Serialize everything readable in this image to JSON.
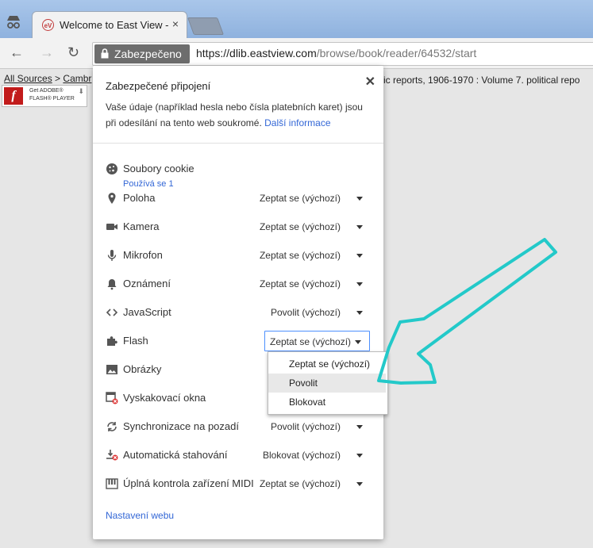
{
  "browser": {
    "tab_title": "Welcome to East View -",
    "tab_close": "×",
    "secure_label": "Zabezpečeno",
    "url_scheme": "https://",
    "url_host": "dlib.eastview.com",
    "url_path": "/browse/book/reader/64532/start",
    "back_glyph": "←",
    "forward_glyph": "→",
    "reload_glyph": "↻"
  },
  "page": {
    "crumb_all": "All Sources",
    "crumb_sep": ">",
    "crumb_next": "Cambr",
    "crumb_right": "ic reports, 1906-1970 : Volume 7. political repo",
    "flash_line1": "Get ADOBE®",
    "flash_line2": "FLASH® PLAYER",
    "flash_logo": "f",
    "flash_dl": "⬇"
  },
  "popup": {
    "title": "Zabezpečené připojení",
    "close": "✕",
    "desc": "Vaše údaje (například hesla nebo čísla platebních karet) jsou při odesílání na tento web soukromé.",
    "more_link": "Další informace",
    "cookies_label": "Soubory cookie",
    "cookies_sub": "Používá se 1",
    "permissions": [
      {
        "label": "Poloha",
        "value": "Zeptat se (výchozí)",
        "icon": "location-pin-icon"
      },
      {
        "label": "Kamera",
        "value": "Zeptat se (výchozí)",
        "icon": "camera-icon"
      },
      {
        "label": "Mikrofon",
        "value": "Zeptat se (výchozí)",
        "icon": "microphone-icon"
      },
      {
        "label": "Oznámení",
        "value": "Zeptat se (výchozí)",
        "icon": "bell-icon"
      },
      {
        "label": "JavaScript",
        "value": "Povolit (výchozí)",
        "icon": "code-icon"
      },
      {
        "label": "Flash",
        "value": "Zeptat se (výchozí)",
        "icon": "puzzle-icon"
      },
      {
        "label": "Obrázky",
        "value": "",
        "icon": "image-icon"
      },
      {
        "label": "Vyskakovací okna",
        "value": "",
        "icon": "popup-blocked-icon"
      },
      {
        "label": "Synchronizace na pozadí",
        "value": "Povolit (výchozí)",
        "icon": "sync-icon"
      },
      {
        "label": "Automatická stahování",
        "value": "Blokovat (výchozí)",
        "icon": "download-icon"
      },
      {
        "label": "Úplná kontrola zařízení MIDI",
        "value": "Zeptat se (výchozí)",
        "icon": "piano-icon"
      }
    ],
    "settings_link": "Nastavení webu"
  },
  "dropdown": {
    "options": [
      "Zeptat se (výchozí)",
      "Povolit",
      "Blokovat"
    ],
    "highlighted": "Povolit"
  },
  "colors": {
    "link": "#3367d6",
    "annotation_arrow": "#23c9c9",
    "secure_chip": "#6d6d6d"
  }
}
